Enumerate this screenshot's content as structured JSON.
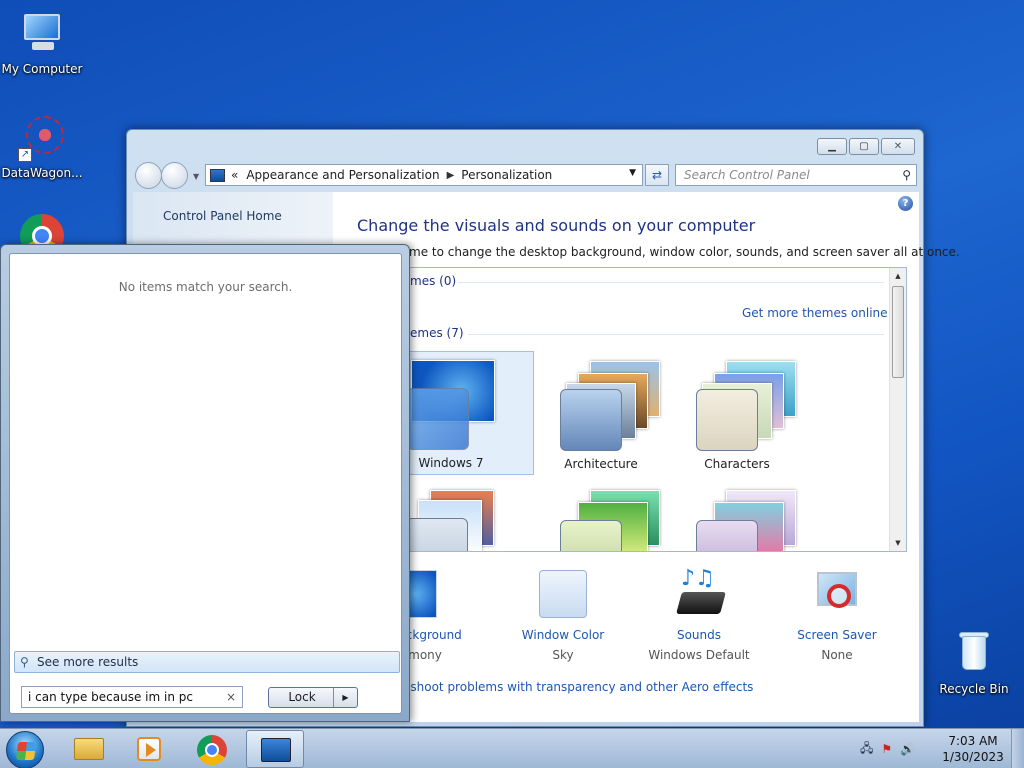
{
  "desktop": {
    "icons": [
      {
        "label": "My Computer"
      },
      {
        "label": "DataWagon..."
      },
      {
        "label": "Recycle Bin"
      }
    ]
  },
  "window": {
    "breadcrumb_prefix": "«",
    "breadcrumb": [
      "Appearance and Personalization",
      "Personalization"
    ],
    "search_placeholder": "Search Control Panel",
    "left_nav": {
      "home": "Control Panel Home"
    },
    "title": "Change the visuals and sounds on your computer",
    "subtitle": "me to change the desktop background, window color, sounds, and screen saver all at once.",
    "groups": [
      {
        "label": "mes (0)"
      },
      {
        "label": "emes (7)"
      }
    ],
    "get_more_link": "Get more themes online",
    "themes": [
      {
        "name": "Windows 7",
        "selected": true
      },
      {
        "name": "Architecture",
        "selected": false
      },
      {
        "name": "Characters",
        "selected": false
      }
    ],
    "bottom_items": [
      {
        "label": "Background",
        "value": "armony",
        "icon": "desktop-background-icon"
      },
      {
        "label": "Window Color",
        "value": "Sky",
        "icon": "window-color-icon"
      },
      {
        "label": "Sounds",
        "value": "Windows Default",
        "icon": "sounds-icon"
      },
      {
        "label": "Screen Saver",
        "value": "None",
        "icon": "screen-saver-icon"
      }
    ],
    "aero_link": "eshoot problems with transparency and other Aero effects",
    "help": "?"
  },
  "start_menu": {
    "no_items": "No items match your search.",
    "see_more": "See more results",
    "search_value": "i can type because im in pc",
    "clear": "×",
    "lock_label": "Lock",
    "lock_arrow": "▶"
  },
  "taskbar": {
    "time": "7:03 AM",
    "date": "1/30/2023"
  },
  "colors": {
    "link": "#1b57b1",
    "title": "#1e3287",
    "desktop": "#1e66d0"
  }
}
